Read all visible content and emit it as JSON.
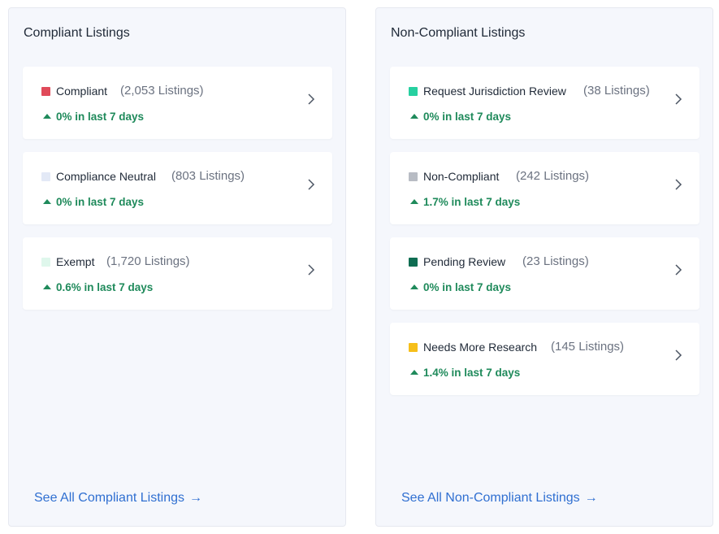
{
  "compliant_panel": {
    "title": "Compliant Listings",
    "see_all": "See All Compliant Listings",
    "cards": [
      {
        "name": "Compliant",
        "count": "(2,053 Listings)",
        "trend": "0% in last 7 days",
        "color": "#e04a5a"
      },
      {
        "name": "Compliance Neutral",
        "count": "(803 Listings)",
        "trend": "0% in last 7 days",
        "color": "#e3e9f6"
      },
      {
        "name": "Exempt",
        "count": "(1,720 Listings)",
        "trend": "0.6% in last 7 days",
        "color": "#dff7ec"
      }
    ]
  },
  "noncompliant_panel": {
    "title": "Non-Compliant Listings",
    "see_all": "See All Non-Compliant Listings",
    "cards": [
      {
        "name": "Request Jurisdiction Review",
        "count": "(38 Listings)",
        "trend": "0% in last 7 days",
        "color": "#26d0a0"
      },
      {
        "name": "Non-Compliant",
        "count": "(242 Listings)",
        "trend": "1.7% in last 7 days",
        "color": "#b8bcc4"
      },
      {
        "name": "Pending Review",
        "count": "(23 Listings)",
        "trend": "0% in last 7 days",
        "color": "#0f6d52"
      },
      {
        "name": "Needs More Research",
        "count": "(145 Listings)",
        "trend": "1.4% in last 7 days",
        "color": "#f6bf1a"
      }
    ]
  },
  "icons": {
    "trend": "triangle-up-icon",
    "card_action": "chevron-right-icon",
    "see_all_arrow": "arrow-right-icon"
  },
  "colors": {
    "trend_green": "#1f8a5b",
    "link_blue": "#2f6fd1",
    "panel_bg": "#f5f7fc"
  }
}
